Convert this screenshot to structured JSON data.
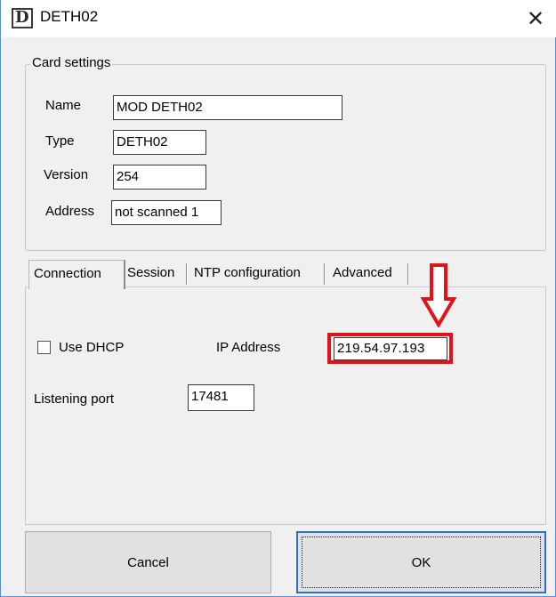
{
  "window": {
    "title": "DETH02",
    "close_glyph": "✕",
    "app_icon": "window-app-icon",
    "app_icon_glyph": "D"
  },
  "card_settings": {
    "legend": "Card settings",
    "name_label": "Name",
    "name_value": "MOD DETH02",
    "type_label": "Type",
    "type_value": "DETH02",
    "version_label": "Version",
    "version_value": "254",
    "address_label": "Address",
    "address_value": "not scanned 1"
  },
  "tabs": [
    {
      "label": "Connection",
      "active": true
    },
    {
      "label": "Session",
      "active": false
    },
    {
      "label": "NTP configuration",
      "active": false
    },
    {
      "label": "Advanced",
      "active": false
    }
  ],
  "connection": {
    "use_dhcp_label": "Use DHCP",
    "use_dhcp_checked": false,
    "ip_label": "IP Address",
    "ip_value": "219.54.97.193",
    "port_label": "Listening port",
    "port_value": "17481"
  },
  "buttons": {
    "cancel": "Cancel",
    "ok": "OK"
  },
  "colors": {
    "highlight": "#e0121a",
    "window_border": "#5b8fd4",
    "focus_border": "#2e6fd1",
    "face": "#f0f0f0"
  },
  "icons": {
    "annotation": "down-arrow-icon",
    "close": "close-icon"
  }
}
